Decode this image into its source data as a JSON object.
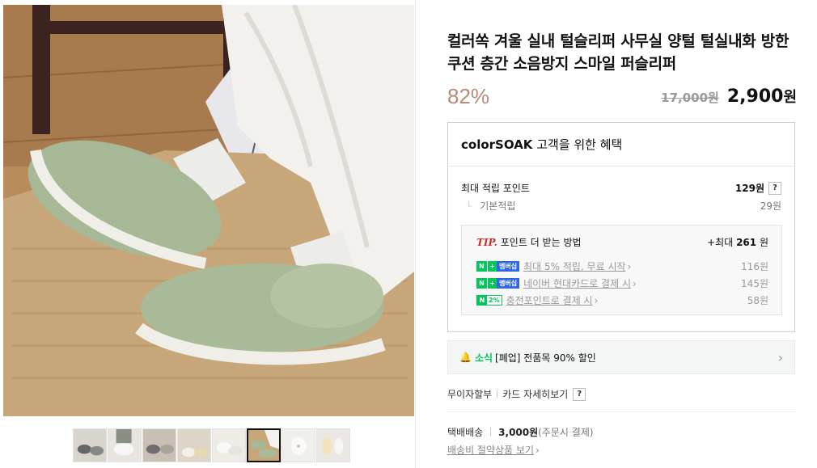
{
  "product": {
    "title": "컬러쏙 겨울 실내 털슬리퍼 사무실 양털 털실내화 방한 쿠션 층간 소음방지 스마일 퍼슬리퍼",
    "discount": "82%",
    "original_price": "17,000원",
    "sale_price": "2,900",
    "sale_unit": "원"
  },
  "gallery": {
    "thumbnail_count": 8,
    "active_thumbnail": 5
  },
  "benefits": {
    "store": "colorSOAK",
    "heading_suffix": " 고객을 위한 혜택",
    "max_points_label": "최대 적립 포인트",
    "max_points_value": "129원",
    "help": "?",
    "basic_label": "기본적립",
    "basic_value": "29원",
    "tip": {
      "tip_word": "TIP.",
      "tip_text": "포인트 더 받는 방법",
      "max_prefix": "+최대 ",
      "max_value": "261",
      "max_unit": " 원",
      "badge_n": "N",
      "badge_plus": "+",
      "badge_membership": "멤버십",
      "badge_pct": "2%",
      "rows": [
        {
          "text": "최대 5% 적립, 무료 시작",
          "amount": "116원"
        },
        {
          "text": "네이버 현대카드로 결제 시",
          "amount": "145원"
        },
        {
          "text": "충전포인트로 결제 시",
          "amount": "58원"
        }
      ]
    }
  },
  "notice": {
    "tag": "소식",
    "text": "[폐업] 전품목 90% 할인"
  },
  "links": {
    "installment": "무이자할부",
    "card_detail": "카드 자세히보기",
    "help": "?"
  },
  "shipping": {
    "label": "택배배송",
    "fee": "3,000원",
    "fee_note": "(주문시 결제)",
    "save_link": "배송비 절약상품 보기"
  },
  "icons": {
    "bell": "bell-icon",
    "chevron": "chevron-right-icon"
  },
  "colors": {
    "naver_green": "#03c75a",
    "membership_blue": "#2d66e8",
    "discount": "#b88a7a",
    "tip_red": "#d12b2b"
  }
}
